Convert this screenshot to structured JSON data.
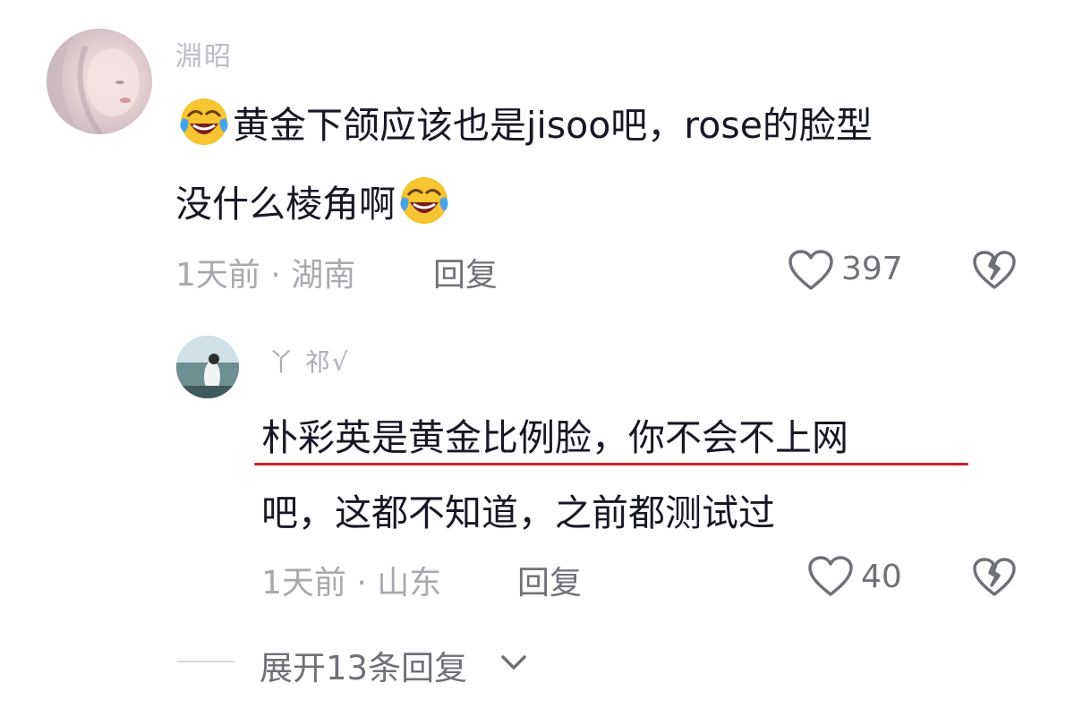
{
  "comment": {
    "username": "淵昭",
    "text_line1": "黄金下颌应该也是jisoo吧，rose的脸型",
    "text_line2": "没什么棱角啊",
    "meta": "1天前 · 湖南",
    "reply_label": "回复",
    "likes": "397",
    "emoji": "face-with-tears-of-joy"
  },
  "reply": {
    "username": "丫 祁√",
    "text_line1": "朴彩英是黄金比例脸，你不会不上网",
    "text_line2": "吧，这都不知道，之前都测试过",
    "meta": "1天前 · 山东",
    "reply_label": "回复",
    "likes": "40",
    "highlight_color": "#c8202b"
  },
  "expand": {
    "label": "展开13条回复"
  },
  "icons": {
    "like": "heart-outline-icon",
    "dislike": "broken-heart-icon",
    "expand": "chevron-down-icon"
  },
  "colors": {
    "text_primary": "#161823",
    "text_secondary": "#a7a9ae",
    "action_text": "#707278",
    "underline": "#c8202b"
  }
}
